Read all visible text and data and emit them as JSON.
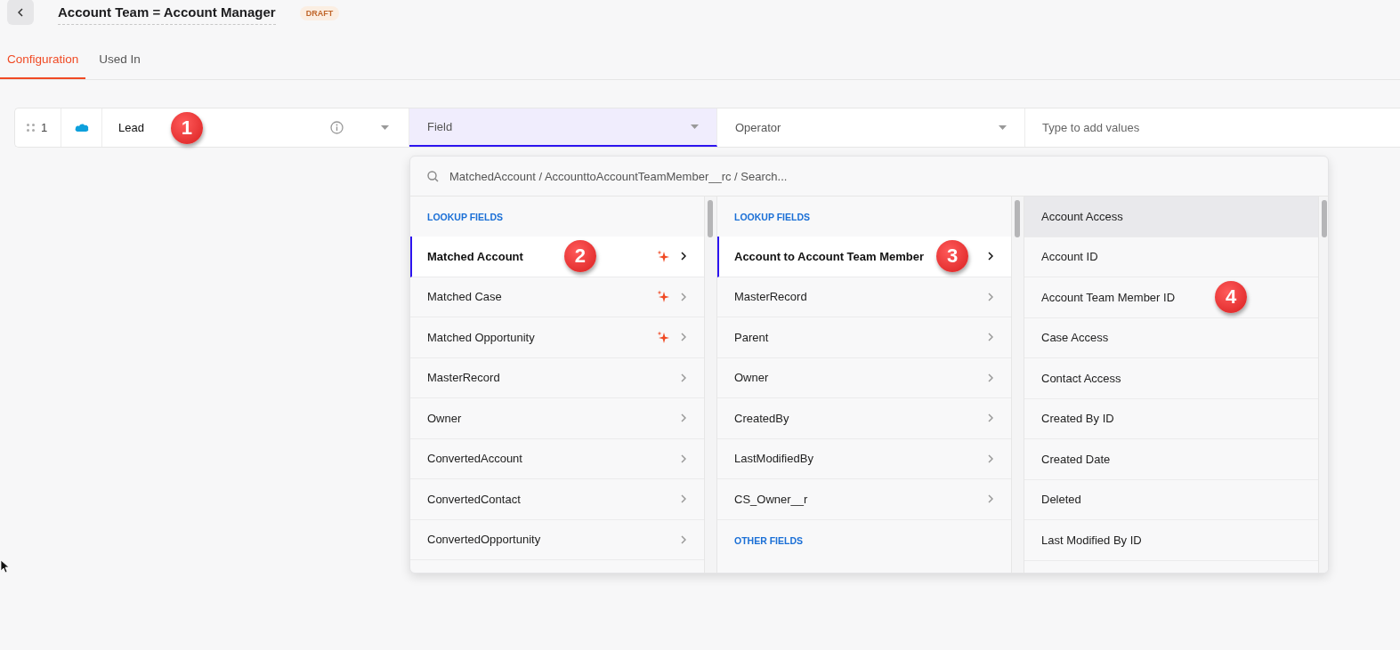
{
  "header": {
    "title": "Account Team = Account Manager",
    "status": "DRAFT"
  },
  "tabs": [
    {
      "label": "Configuration",
      "selected": true
    },
    {
      "label": "Used In",
      "selected": false
    }
  ],
  "rule": {
    "number": "1",
    "cells": [
      {
        "kind": "object",
        "value": "Lead",
        "annotation": "1"
      },
      {
        "kind": "select",
        "placeholder": "Field",
        "active": true
      },
      {
        "kind": "select",
        "placeholder": "Operator",
        "active": false
      },
      {
        "kind": "input",
        "placeholder": "Type to add values"
      }
    ]
  },
  "picker": {
    "search": {
      "value": "MatchedAccount / AccounttoAccountTeamMember__rc / Search..."
    },
    "columns": [
      {
        "items": [
          {
            "kind": "header",
            "label": "LOOKUP FIELDS"
          },
          {
            "kind": "item",
            "label": "Matched Account",
            "selected": true,
            "ai": true,
            "has_children": true,
            "hovered": false,
            "annotation": "2"
          },
          {
            "kind": "item",
            "label": "Matched Case",
            "selected": false,
            "ai": true,
            "has_children": true,
            "hovered": false
          },
          {
            "kind": "item",
            "label": "Matched Opportunity",
            "selected": false,
            "ai": true,
            "has_children": true,
            "hovered": false
          },
          {
            "kind": "item",
            "label": "MasterRecord",
            "selected": false,
            "ai": false,
            "has_children": true,
            "hovered": false
          },
          {
            "kind": "item",
            "label": "Owner",
            "selected": false,
            "ai": false,
            "has_children": true,
            "hovered": false
          },
          {
            "kind": "item",
            "label": "ConvertedAccount",
            "selected": false,
            "ai": false,
            "has_children": true,
            "hovered": false
          },
          {
            "kind": "item",
            "label": "ConvertedContact",
            "selected": false,
            "ai": false,
            "has_children": true,
            "hovered": false
          },
          {
            "kind": "item",
            "label": "ConvertedOpportunity",
            "selected": false,
            "ai": false,
            "has_children": true,
            "hovered": false
          }
        ]
      },
      {
        "items": [
          {
            "kind": "header",
            "label": "LOOKUP FIELDS"
          },
          {
            "kind": "item",
            "label": "Account to Account Team Member",
            "selected": true,
            "ai": false,
            "has_children": true,
            "hovered": false,
            "annotation": "3"
          },
          {
            "kind": "item",
            "label": "MasterRecord",
            "selected": false,
            "ai": false,
            "has_children": true,
            "hovered": false
          },
          {
            "kind": "item",
            "label": "Parent",
            "selected": false,
            "ai": false,
            "has_children": true,
            "hovered": false
          },
          {
            "kind": "item",
            "label": "Owner",
            "selected": false,
            "ai": false,
            "has_children": true,
            "hovered": false
          },
          {
            "kind": "item",
            "label": "CreatedBy",
            "selected": false,
            "ai": false,
            "has_children": true,
            "hovered": false
          },
          {
            "kind": "item",
            "label": "LastModifiedBy",
            "selected": false,
            "ai": false,
            "has_children": true,
            "hovered": false
          },
          {
            "kind": "item",
            "label": "CS_Owner__r",
            "selected": false,
            "ai": false,
            "has_children": true,
            "hovered": false
          },
          {
            "kind": "header",
            "label": "OTHER FIELDS"
          }
        ]
      },
      {
        "items": [
          {
            "kind": "item",
            "label": "Account Access",
            "hovered": true
          },
          {
            "kind": "item",
            "label": "Account ID",
            "hovered": false
          },
          {
            "kind": "item",
            "label": "Account Team Member ID",
            "hovered": false,
            "annotation": "4"
          },
          {
            "kind": "item",
            "label": "Case Access",
            "hovered": false
          },
          {
            "kind": "item",
            "label": "Contact Access",
            "hovered": false
          },
          {
            "kind": "item",
            "label": "Created By ID",
            "hovered": false
          },
          {
            "kind": "item",
            "label": "Created Date",
            "hovered": false
          },
          {
            "kind": "item",
            "label": "Deleted",
            "hovered": false
          },
          {
            "kind": "item",
            "label": "Last Modified By ID",
            "hovered": false
          }
        ]
      }
    ]
  }
}
